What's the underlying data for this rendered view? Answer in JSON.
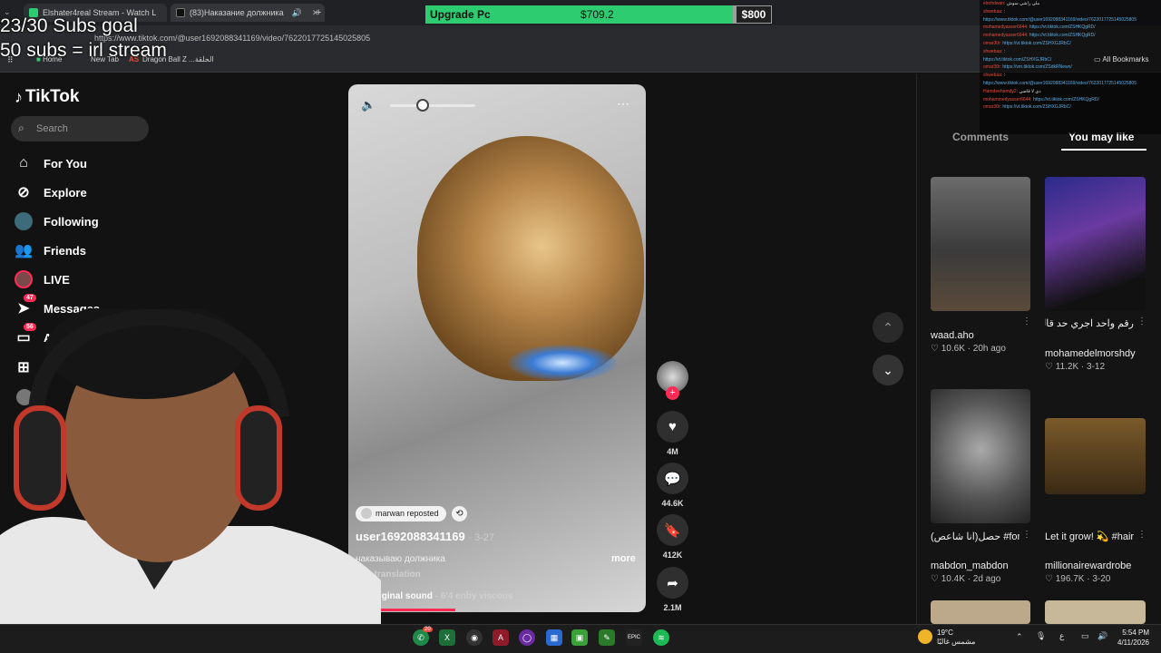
{
  "browser": {
    "tabs": [
      {
        "label": "Elshater4real Stream - Watch L",
        "color": "#2ecc71"
      },
      {
        "label": "(83)Наказание должника",
        "color": "#e0e0e0"
      }
    ],
    "url": "https://www.tiktok.com/@user1692088341169/video/7622017725145025805",
    "bookmarks": [
      "Home",
      "New Tab",
      "AS",
      "Dragon Ball Z ...الحلقة"
    ],
    "all_bookmarks": "All Bookmarks"
  },
  "overlay": {
    "goal_label": "Upgrade Pc",
    "goal_current": "$709.2",
    "goal_target": "$800",
    "goal_progress": 0.887,
    "subs_goal": "23/30 Subs goal",
    "subs_note": "50 subs = irl stream"
  },
  "chat": [
    {
      "user": "elrohdwan",
      "text": "ملي راشي سوش"
    },
    {
      "user": "shwebaa",
      "text": ":"
    },
    {
      "user": "",
      "text": "https://www.tiktok.com/@user1692088341169/video/7622017725145025805"
    },
    {
      "user": "mohamedyasser6644",
      "text": "https://vt.tiktok.com/ZSHKQgRD/"
    },
    {
      "user": "mohamedyasser6644",
      "text": "https://vt.tiktok.com/ZSHKQgRD/"
    },
    {
      "user": "omar30r",
      "text": "https://vt.tiktok.com/ZSHXGJRbC/"
    },
    {
      "user": "shwebaa",
      "text": ":"
    },
    {
      "user": "",
      "text": "https://vt.tiktok.com/ZSHXGJRbC/"
    },
    {
      "user": "omar30r",
      "text": "https://vm.tiktok.com/ZSdkRNewn/"
    },
    {
      "user": "shwebaa",
      "text": ":"
    },
    {
      "user": "",
      "text": "https://www.tiktok.com/@user1692088341169/video/7622017725145025805"
    },
    {
      "user": "Hamdeehamdy2",
      "text": "دي لا قاضي"
    },
    {
      "user": "mohammedyasser6644",
      "text": "https://vt.tiktok.com/ZSHKQgRD/"
    },
    {
      "user": "omar30r",
      "text": "https://vt.tiktok.com/ZSHXGJRbC/"
    }
  ],
  "tiktok": {
    "logo": "TikTok",
    "search_placeholder": "Search",
    "nav": [
      {
        "label": "For You",
        "icon": "home-icon"
      },
      {
        "label": "Explore",
        "icon": "compass-icon"
      },
      {
        "label": "Following",
        "icon": "following-icon"
      },
      {
        "label": "Friends",
        "icon": "friends-icon"
      },
      {
        "label": "LIVE",
        "icon": "live-icon"
      },
      {
        "label": "Messages",
        "icon": "send-icon",
        "badge": "47"
      },
      {
        "label": "Acti",
        "icon": "inbox-icon",
        "badge": "56"
      },
      {
        "label": "U",
        "icon": "upload-icon"
      }
    ],
    "video": {
      "reposted_by": "marwan reposted",
      "author": "user1692088341169",
      "date": "· 3-27",
      "description": "наказываю должника",
      "more": "more",
      "see_translation": "See translation",
      "sound": "original sound",
      "sound_artist": "- 6'4 enby viscous",
      "progress": 0.3
    },
    "actions": [
      {
        "icon": "heart-icon",
        "count": "4M"
      },
      {
        "icon": "comment-icon",
        "count": "44.6K"
      },
      {
        "icon": "bookmark-icon",
        "count": "412K"
      },
      {
        "icon": "share-icon",
        "count": "2.1M"
      }
    ],
    "panel_tabs": {
      "comments": "Comments",
      "you_may_like": "You may like"
    },
    "recommendations": [
      {
        "title": "",
        "author": "waad.aho",
        "likes": "10.6K",
        "age": "20h ago"
      },
      {
        "title": "رقم واحد اجري حد قال 🔥 هجري...",
        "author": "mohamedelmorshdy",
        "likes": "11.2K",
        "age": "3-12"
      },
      {
        "title": "حصل(انا شاعص) #foryou #mems...",
        "author": "mabdon_mabdon",
        "likes": "10.4K",
        "age": "2d ago"
      },
      {
        "title": "Let it grow! 💫 #hair #blonde...",
        "author": "millionairewardrobe",
        "likes": "196.7K",
        "age": "3-20"
      }
    ]
  },
  "taskbar": {
    "weather_temp": "19°C",
    "weather_desc": "مشمس غالبًا",
    "time": "5:54 PM",
    "date": "4/11/2026",
    "whatsapp_badge": "20",
    "lang": "ع"
  }
}
